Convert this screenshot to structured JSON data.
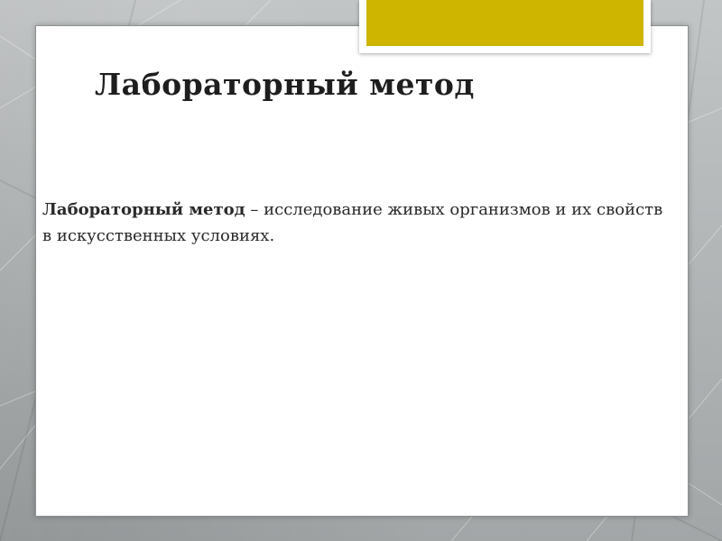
{
  "slide": {
    "title": "Лабораторный метод",
    "definition": {
      "term": "Лабораторный метод",
      "body": " – исследование живых организмов и их свойств в искусственных условиях."
    }
  },
  "colors": {
    "accent": "#cdb500",
    "background": "#b4b8b9",
    "panel": "#ffffff",
    "text": "#1e1e1e"
  }
}
